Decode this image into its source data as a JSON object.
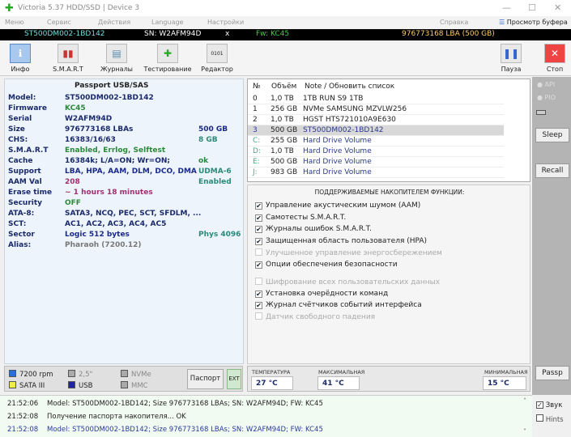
{
  "title": "Victoria 5.37 HDD/SSD | Device 3",
  "window": {
    "minimize": "—",
    "maximize": "☐",
    "close": "✕"
  },
  "menu": [
    "Меню",
    "Сервис",
    "Действия",
    "Language",
    "Настройки",
    "Справка",
    "Просмотр буфера"
  ],
  "devbar": {
    "model": "ST500DM002-1BD142",
    "sn": "SN: W2AFM94D",
    "x": "x",
    "fw": "Fw: KC45",
    "lba": "976773168 LBA (500 GB)"
  },
  "toolbar": [
    {
      "label": "Инфо",
      "icon": "info-icon"
    },
    {
      "label": "S.M.A.R.T",
      "icon": "smart-chart-icon"
    },
    {
      "label": "Журналы",
      "icon": "logs-folder-icon"
    },
    {
      "label": "Тестирование",
      "icon": "test-plus-icon"
    },
    {
      "label": "Редактор",
      "icon": "binary-editor-icon"
    },
    {
      "label": "Пауза",
      "icon": "pause-icon"
    },
    {
      "label": "Стоп",
      "icon": "stop-icon"
    }
  ],
  "passport": {
    "header": "Passport USB/SAS",
    "rows": [
      {
        "k": "Model:",
        "v": "ST500DM002-1BD142",
        "x": ""
      },
      {
        "k": "Firmware",
        "v": "KC45",
        "x": ""
      },
      {
        "k": "Serial",
        "v": "W2AFM94D",
        "x": ""
      },
      {
        "k": "Size",
        "v": "976773168 LBAs",
        "x": "500 GB"
      },
      {
        "k": "CHS:",
        "v": "16383/16/63",
        "x": "8 GB"
      },
      {
        "k": "S.M.A.R.T",
        "v": "Enabled, Errlog, Selftest",
        "x": ""
      },
      {
        "k": "Cache",
        "v": "16384k; L/A=ON; Wr=ON;",
        "x": "ok"
      },
      {
        "k": "Support",
        "v": "LBA, HPA, AAM, DLM, DCO, DMA",
        "x": "UDMA-6"
      },
      {
        "k": "AAM Val",
        "v": "208",
        "x": "Enabled"
      },
      {
        "k": "Erase time",
        "v": "~ 1 hours 18 minutes",
        "x": ""
      },
      {
        "k": "Security",
        "v": "OFF",
        "x": ""
      },
      {
        "k": "ATA-8:",
        "v": "SATA3, NCQ, PEC, SCT, SFDLM, ...",
        "x": ""
      },
      {
        "k": "SCT:",
        "v": "AC1, AC2, AC3, AC4, AC5",
        "x": ""
      },
      {
        "k": "Sector",
        "v": "Logic 512 bytes",
        "x": "Phys 4096"
      },
      {
        "k": "Alias:",
        "v": "Pharaoh (7200.12)",
        "x": ""
      }
    ]
  },
  "drives": {
    "headers": [
      "№",
      "Объём",
      "Note / Обновить список"
    ],
    "rows": [
      [
        "0",
        "1,0 TB",
        "1TB RUN S9 1TB"
      ],
      [
        "1",
        "256 GB",
        "NVMe    SAMSUNG MZVLW256"
      ],
      [
        "2",
        "1,0 TB",
        "HGST HTS721010A9E630"
      ],
      [
        "3",
        "500 GB",
        "ST500DM002-1BD142"
      ],
      [
        "C:",
        "255 GB",
        "Hard Drive Volume"
      ],
      [
        "D:",
        "1,0 TB",
        "Hard Drive Volume"
      ],
      [
        "E:",
        "500 GB",
        "Hard Drive Volume"
      ],
      [
        "J:",
        "983 GB",
        "Hard Drive Volume"
      ]
    ]
  },
  "features": {
    "title": "ПОДДЕРЖИВАЕМЫЕ НАКОПИТЕЛЕМ ФУНКЦИИ:",
    "items": [
      {
        "label": "Управление акустическим шумом (AAM)",
        "checked": true
      },
      {
        "label": "Самотесты S.M.A.R.T.",
        "checked": true
      },
      {
        "label": "Журналы ошибок S.M.A.R.T.",
        "checked": true
      },
      {
        "label": "Защищенная область пользователя (HPA)",
        "checked": true
      },
      {
        "label": "Улучшенное управление энергосбережением",
        "checked": false
      },
      {
        "label": "Опции обеспечения безопасности",
        "checked": true
      },
      {
        "label": "Шифрование всех пользовательских данных",
        "checked": false
      },
      {
        "label": "Установка очерёдности команд",
        "checked": true
      },
      {
        "label": "Журнал счётчиков событий интерфейса",
        "checked": true
      },
      {
        "label": "Датчик свободного падения",
        "checked": false
      }
    ]
  },
  "side": {
    "api": "API",
    "pio": "PIO",
    "sleep": "Sleep",
    "recall": "Recall",
    "passp": "Passp",
    "sound": "Звук",
    "hints": "Hints"
  },
  "status": {
    "rpm": "7200 rpm",
    "form": "2,5\"",
    "nvme": "NVMe",
    "sata": "SATA III",
    "usb": "USB",
    "mmc": "MMC",
    "passport_btn": "Паспорт",
    "ext_btn": "EXT"
  },
  "temps": {
    "cur_label": "ТЕМПЕРАТУРА",
    "cur": "27 °C",
    "max_label": "МАКСИМАЛЬНАЯ",
    "max": "41 °C",
    "min_label": "МИНИМАЛЬНАЯ",
    "min": "15 °C"
  },
  "log": [
    {
      "time": "21:52:06",
      "msg": "Model: ST500DM002-1BD142; Size 976773168 LBAs; SN: W2AFM94D; FW: KC45"
    },
    {
      "time": "21:52:08",
      "msg": "Получение паспорта накопителя... OK"
    },
    {
      "time": "21:52:08",
      "msg": "Model: ST500DM002-1BD142; Size 976773168 LBAs; SN: W2AFM94D; FW: KC45"
    }
  ]
}
